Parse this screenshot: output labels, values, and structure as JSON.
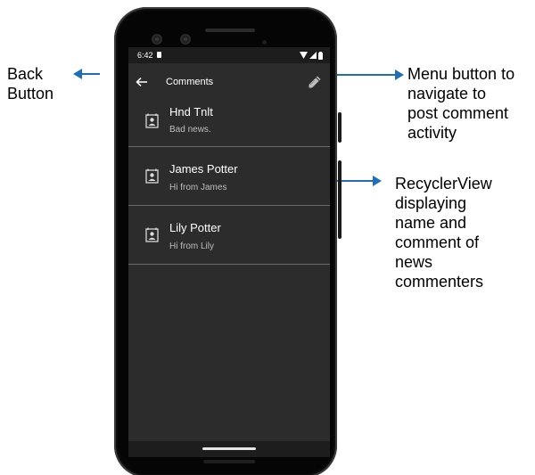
{
  "status_bar": {
    "time": "6:42"
  },
  "app_bar": {
    "title": "Comments",
    "back_icon": "arrow-back-icon",
    "menu_icon": "pencil-icon"
  },
  "comments": [
    {
      "name": "Hnd Tnlt",
      "comment": "Bad news.",
      "icon": "contact-card-icon"
    },
    {
      "name": "James Potter",
      "comment": "Hi from James",
      "icon": "contact-card-icon"
    },
    {
      "name": "Lily Potter",
      "comment": "Hi from Lily",
      "icon": "contact-card-icon"
    }
  ],
  "annotations": {
    "back_button": "Back\nButton",
    "menu_button": "Menu button to\nnavigate to\npost comment\nactivity",
    "recycler_view": "RecyclerView\ndisplaying\nname and\ncomment of\nnews\ncommenters"
  },
  "colors": {
    "screen_background": "#2c2c2c",
    "bar_background": "#1d1d1d",
    "annotation_arrow": "#1f6fb8"
  }
}
